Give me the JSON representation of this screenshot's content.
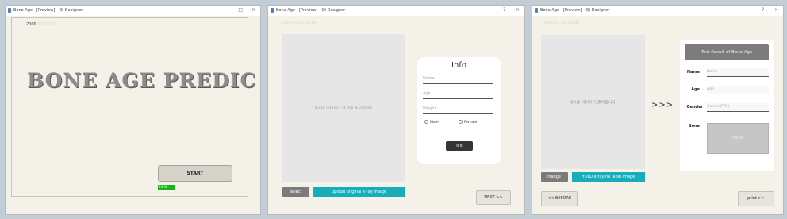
{
  "windows": [
    {
      "title": "Bone Age - [Preview] - Qt Designer",
      "controls": [
        "□",
        "×"
      ]
    },
    {
      "title": "Bone Age - [Preview] - Qt Designer",
      "controls": [
        "?",
        "×"
      ]
    },
    {
      "title": "Bone Age - [Preview] - Qt Designer",
      "controls": [
        "?",
        "×"
      ]
    }
  ],
  "start_screen": {
    "year": "2000",
    "timestamp_faint": "00:00:00",
    "title": "BONE AGE PREDIC",
    "start_label": "START",
    "progress_label": "24 %",
    "progress_value": 0.24
  },
  "input_screen": {
    "timestamp": "2000-01-01 00:00",
    "image_placeholder": "X-ray 이미지가 여기에 표시됩니다",
    "select_label": "select",
    "upload_label": "upload original x-ray image",
    "info": {
      "title": "Info",
      "name_placeholder": "Name",
      "age_placeholder": "Age",
      "height_placeholder": "Height",
      "male_label": "Male",
      "female_label": "Female",
      "ok_label": "o k"
    },
    "next_label": "NEXT >>"
  },
  "result_screen": {
    "timestamp": "2000-01-01 00:00",
    "image_placeholder": "레이블 이미지가 출력됩니다.",
    "change_label": "change_",
    "yolo_label": "YOLO x-ray roi label image",
    "arrow": ">>>",
    "result_header": "Test Result of Bone Age",
    "name_label": "Name",
    "name_placeholder": "Name",
    "age_label": "Age",
    "age_placeholder": "Age",
    "gender_label": "Gender",
    "gender_placeholder": "Gender(F/M)",
    "bone_label": "Bone",
    "bone_value": "result",
    "before_label": "<< BEFORE",
    "print_label": "print >>"
  },
  "colors": {
    "window_bg": "#f4f1e8",
    "progress": "#18b418",
    "teal": "#17aebb",
    "dark_button": "#353535"
  }
}
